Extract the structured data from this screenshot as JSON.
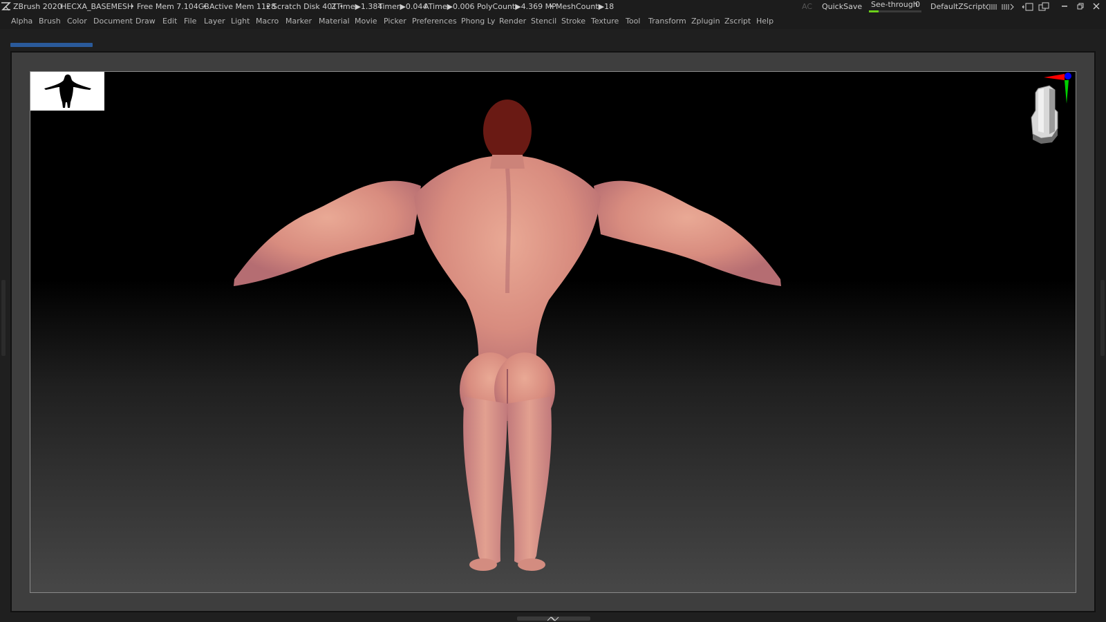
{
  "app": {
    "title": "ZBrush 2020",
    "document": "HECXA_BASEMESH"
  },
  "stats": {
    "free_mem": "• Free Mem 7.104GB",
    "active_mem": "• Active Mem 1128",
    "scratch_disk": "• Scratch Disk 401 •",
    "ztime": "ZTime▶1.384",
    "timer": "Timer▶0.044",
    "atime": "ATime▶0.006",
    "polycount": "PolyCount▶4.369 MP",
    "meshcount": "• MeshCount▶18"
  },
  "header_right": {
    "ac": "AC",
    "quicksave": "QuickSave",
    "see_through_label": "See-through",
    "see_through_value": "0",
    "see_through_level": 0,
    "script": "DefaultZScript"
  },
  "menu": [
    "Alpha",
    "Brush",
    "Color",
    "Document",
    "Draw",
    "Edit",
    "File",
    "Layer",
    "Light",
    "Macro",
    "Marker",
    "Material",
    "Movie",
    "Picker",
    "Preferences",
    "Phong Ly",
    "Render",
    "Stencil",
    "Stroke",
    "Texture",
    "Tool",
    "Transform",
    "Zplugin",
    "Zscript",
    "Help"
  ],
  "colors": {
    "accent": "#2a5a9a",
    "see_through_bar": "#6bd11a",
    "skin": "#e3a08f",
    "hair": "#6a1010",
    "axis_x": "#ff0000",
    "axis_y": "#00cc00",
    "axis_z": "#0000ff"
  },
  "icons": {
    "app_logo": "zbrush-logo-icon",
    "navigation_cube": "navigation-cube-icon",
    "thumbnail": "model-silhouette-icon"
  }
}
